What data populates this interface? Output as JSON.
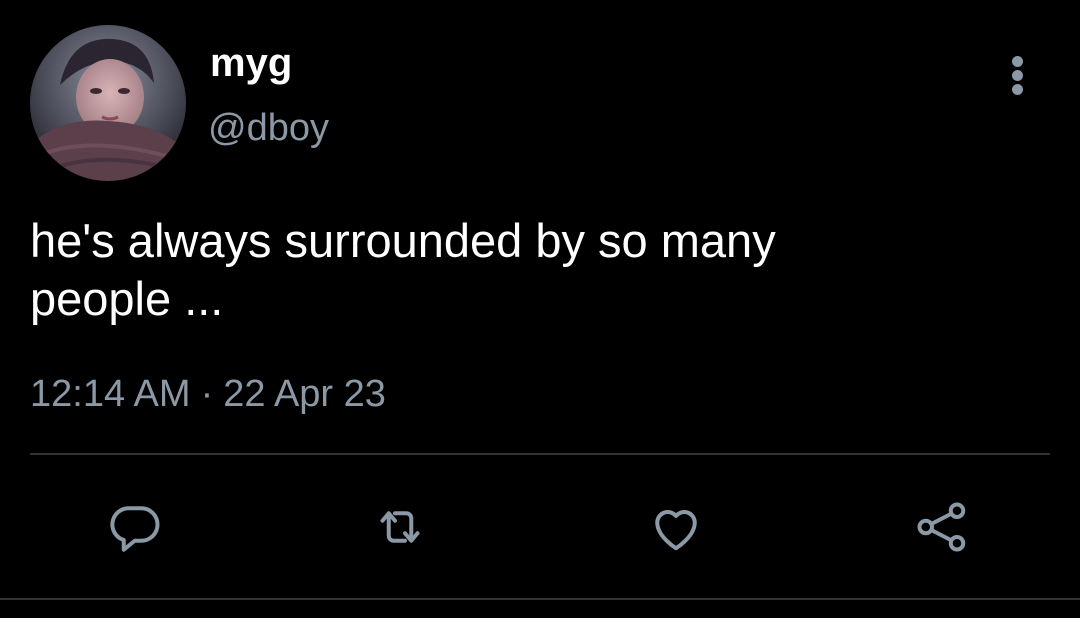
{
  "tweet": {
    "display_name": "myg",
    "handle": "@dboy",
    "text": "he's always surrounded by so many\npeople ...",
    "time": "12:14 AM",
    "separator": "·",
    "date": "22 Apr 23"
  },
  "icons": {
    "more": "more-vertical-icon",
    "reply": "reply-icon",
    "retweet": "retweet-icon",
    "like": "heart-icon",
    "share": "share-icon"
  },
  "colors": {
    "background": "#000000",
    "primary_text": "#ffffff",
    "secondary_text": "#8b98a5",
    "divider": "#2f3336"
  }
}
